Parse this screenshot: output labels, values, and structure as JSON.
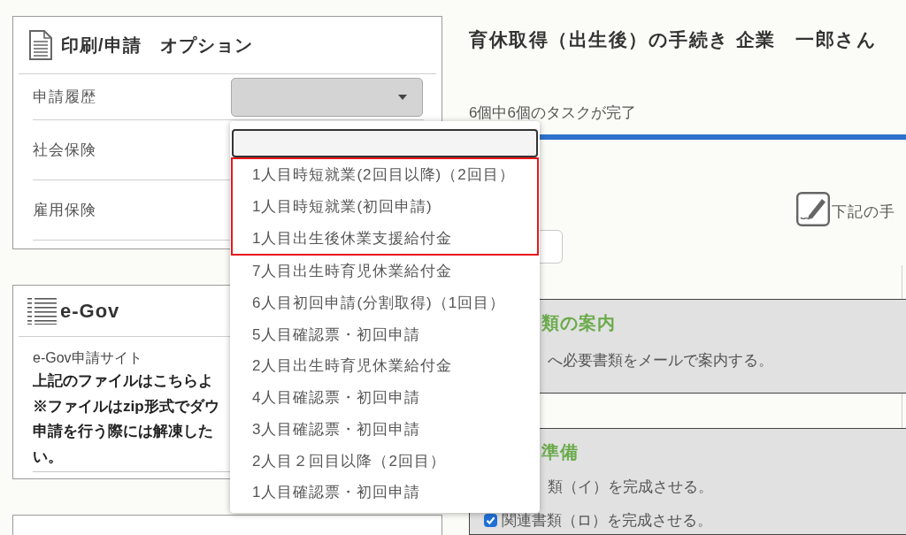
{
  "options_panel": {
    "title": "印刷/申請　オプション",
    "rows": [
      {
        "kind": "select",
        "label": "申請履歴",
        "dropdown": {
          "expanded": true,
          "options": [
            {
              "label": "1人目時短就業(2回目以降)（2回目）",
              "selected": false,
              "highlighted": true
            },
            {
              "label": "1人目時短就業(初回申請)",
              "selected": false,
              "highlighted": true
            },
            {
              "label": "1人目出生後休業支援給付金",
              "selected": false,
              "highlighted": true
            },
            {
              "label": "7人目出生時育児休業給付金",
              "selected": false,
              "highlighted": false
            },
            {
              "label": "6人目初回申請(分割取得)（1回目）",
              "selected": false,
              "highlighted": false
            },
            {
              "label": "5人目確認票・初回申請",
              "selected": false,
              "highlighted": false
            },
            {
              "label": "2人目出生時育児休業給付金",
              "selected": false,
              "highlighted": false
            },
            {
              "label": "4人目確認票・初回申請",
              "selected": false,
              "highlighted": false
            },
            {
              "label": "3人目確認票・初回申請",
              "selected": false,
              "highlighted": false
            },
            {
              "label": "2人目２回目以降（2回目）",
              "selected": false,
              "highlighted": false
            },
            {
              "label": "1人目確認票・初回申請",
              "selected": false,
              "highlighted": false
            }
          ]
        }
      },
      {
        "kind": "plain",
        "label": "社会保険"
      },
      {
        "kind": "plain",
        "label": "雇用保険"
      }
    ]
  },
  "egov_panel": {
    "title": "e-Gov",
    "subtitle": "e-Gov申請サイト",
    "note_lines": [
      "上記のファイルはこちらよ",
      "※ファイルはzip形式でダウ",
      "申請を行う際には解凍した",
      "い。"
    ]
  },
  "page_title": "育休取得（出生後）の手続き 企業　一郎さん",
  "progress": {
    "label": "6個中6個のタスクが完了",
    "level": 1
  },
  "instruction": "下記の手",
  "steps": [
    {
      "title": "類の案内",
      "items": [
        {
          "kind": "text",
          "text": "へ必要書類をメールで案内する。"
        }
      ]
    },
    {
      "title": "準備",
      "items": [
        {
          "kind": "text",
          "text": "類（イ）を完成させる。"
        },
        {
          "kind": "checkbox",
          "text": "関連書類（ロ）を完成させる。",
          "checked": true
        }
      ]
    }
  ]
}
